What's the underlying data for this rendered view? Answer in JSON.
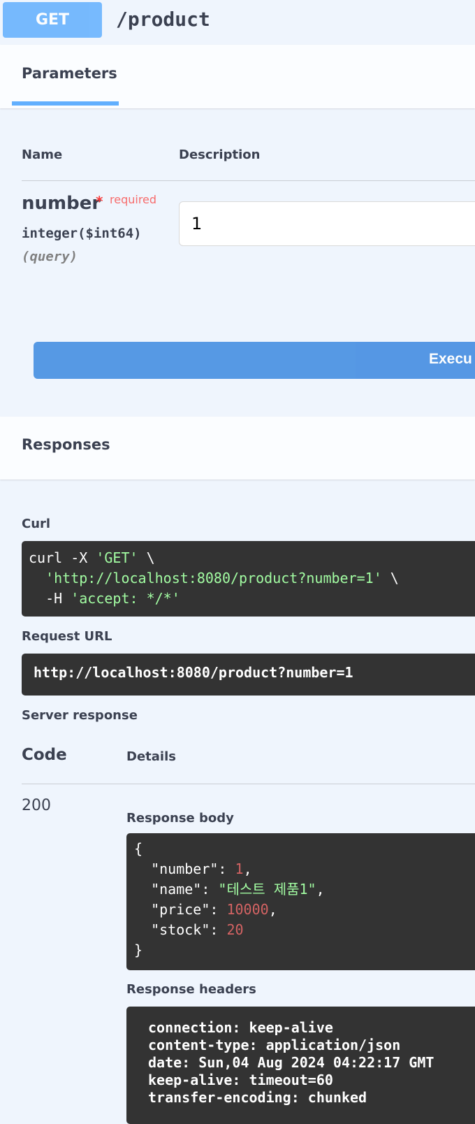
{
  "operation": {
    "method": "GET",
    "path": "/product"
  },
  "tabs": {
    "parameters": "Parameters"
  },
  "params_table": {
    "col_name": "Name",
    "col_description": "Description",
    "param": {
      "name": "number",
      "required_star": "*",
      "required_label": "required",
      "type": "integer($int64)",
      "location": "(query)",
      "value": "1"
    }
  },
  "execute_button": "Execu",
  "responses": {
    "title": "Responses",
    "curl_label": "Curl",
    "curl": {
      "l1_cmd": "curl -X ",
      "l1_str": "'GET'",
      "l1_end": " \\",
      "l2_str": "'http://localhost:8080/product?number=1'",
      "l2_end": " \\",
      "l3_cmd": "  -H ",
      "l3_str": "'accept: */*'"
    },
    "request_url_label": "Request URL",
    "request_url": "http://localhost:8080/product?number=1",
    "server_response_label": "Server response",
    "col_code": "Code",
    "col_details": "Details",
    "status_code": "200",
    "body_label": "Response body",
    "body": {
      "open": "{",
      "k1": "  \"number\"",
      "v1": "1",
      "k2": "  \"name\"",
      "v2": "\"테스트 제품1\"",
      "k3": "  \"price\"",
      "v3": "10000",
      "k4": "  \"stock\"",
      "v4": "20",
      "close": "}"
    },
    "headers_label": "Response headers",
    "headers": [
      "connection: keep-alive",
      "content-type: application/json",
      "date: Sun,04 Aug 2024 04:22:17 GMT",
      "keep-alive: timeout=60",
      "transfer-encoding: chunked"
    ]
  },
  "colors": {
    "get_blue": "#61affe",
    "execute_blue": "#4990e2",
    "code_bg": "#333333",
    "string_green": "#a2fca2",
    "number_red": "#d36363",
    "required_red": "#f93e3e"
  }
}
